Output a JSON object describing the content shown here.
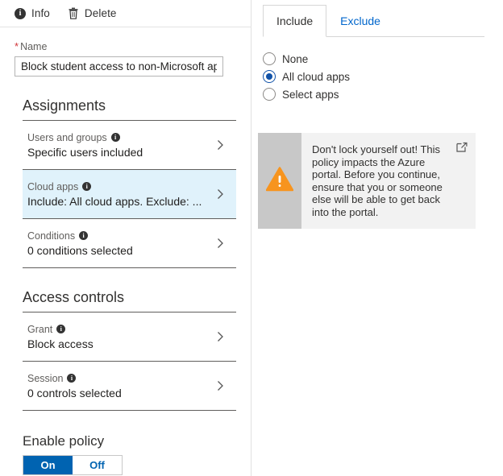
{
  "toolbar": {
    "info_label": "Info",
    "info_icon": "info-circle-icon",
    "delete_label": "Delete",
    "delete_icon": "trash-icon"
  },
  "form": {
    "name_label": "Name",
    "required_marker": "*",
    "name_value": "Block student access to non-Microsoft apps"
  },
  "assignments": {
    "title": "Assignments",
    "rows": [
      {
        "label": "Users and groups",
        "value": "Specific users included",
        "info_icon": "info-circle-icon",
        "chevron_icon": "chevron-right-icon",
        "selected": false
      },
      {
        "label": "Cloud apps",
        "value": "Include: All cloud apps. Exclude: ...",
        "info_icon": "info-circle-icon",
        "chevron_icon": "chevron-right-icon",
        "selected": true
      },
      {
        "label": "Conditions",
        "value": "0 conditions selected",
        "info_icon": "info-circle-icon",
        "chevron_icon": "chevron-right-icon",
        "selected": false
      }
    ]
  },
  "access_controls": {
    "title": "Access controls",
    "rows": [
      {
        "label": "Grant",
        "value": "Block access",
        "info_icon": "info-circle-icon",
        "chevron_icon": "chevron-right-icon",
        "selected": false
      },
      {
        "label": "Session",
        "value": "0 controls selected",
        "info_icon": "info-circle-icon",
        "chevron_icon": "chevron-right-icon",
        "selected": false
      }
    ]
  },
  "enable_policy": {
    "label": "Enable policy",
    "on_label": "On",
    "off_label": "Off",
    "selected": "On"
  },
  "right_panel": {
    "tabs": [
      {
        "label": "Include",
        "active": true
      },
      {
        "label": "Exclude",
        "active": false
      }
    ],
    "options": [
      {
        "label": "None",
        "checked": false
      },
      {
        "label": "All cloud apps",
        "checked": true
      },
      {
        "label": "Select apps",
        "checked": false
      }
    ],
    "warning": {
      "icon": "warning-triangle-icon",
      "text": "Don't lock yourself out! This policy impacts the Azure portal. Before you continue, ensure that you or someone else will be able to get back into the portal.",
      "link_icon": "external-link-icon"
    }
  },
  "colors": {
    "accent_blue": "#0063b1",
    "link_blue": "#0066cc",
    "selected_row": "#e0f2fb",
    "warning_orange": "#f7941e",
    "required_red": "#d13438",
    "warn_bar_gray": "#c8c8c8",
    "warn_body_gray": "#f2f2f2"
  }
}
